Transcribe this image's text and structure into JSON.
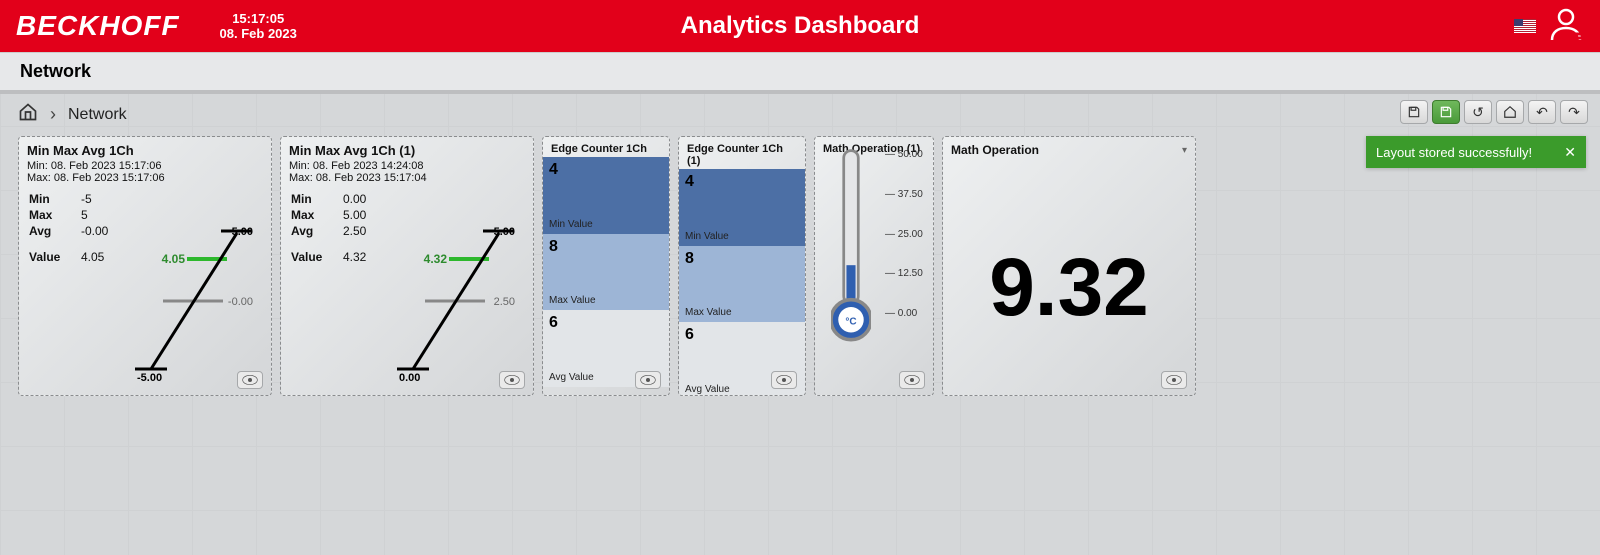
{
  "header": {
    "logo": "BECKHOFF",
    "time": "15:17:05",
    "date": "08. Feb 2023",
    "title": "Analytics Dashboard"
  },
  "tab": {
    "label": "Network"
  },
  "breadcrumb": {
    "current": "Network"
  },
  "toast": {
    "text": "Layout stored successfully!"
  },
  "widgets": {
    "mma1": {
      "title": "Min Max Avg 1Ch",
      "min_ts": "Min:  08. Feb 2023 15:17:06",
      "max_ts": "Max: 08. Feb 2023 15:17:06",
      "min_label": "Min",
      "min": "-5",
      "max_label": "Max",
      "max": "5",
      "avg_label": "Avg",
      "avg": "-0.00",
      "value_label": "Value",
      "value": "4.05",
      "scale_top": "5.00",
      "scale_mid": "-0.00",
      "scale_bot": "-5.00",
      "marker": "4.05"
    },
    "mma2": {
      "title": "Min Max Avg 1Ch (1)",
      "min_ts": "Min:  08. Feb 2023 14:24:08",
      "max_ts": "Max: 08. Feb 2023 15:17:04",
      "min_label": "Min",
      "min": "0.00",
      "max_label": "Max",
      "max": "5.00",
      "avg_label": "Avg",
      "avg": "2.50",
      "value_label": "Value",
      "value": "4.32",
      "scale_top": "5.00",
      "scale_mid": "2.50",
      "scale_bot": "0.00",
      "marker": "4.32"
    },
    "ec1": {
      "title": "Edge Counter 1Ch",
      "min": "4",
      "max": "8",
      "avg": "6",
      "min_label": "Min Value",
      "max_label": "Max Value",
      "avg_label": "Avg Value"
    },
    "ec2": {
      "title": "Edge Counter 1Ch (1)",
      "min": "4",
      "max": "8",
      "avg": "6",
      "min_label": "Min Value",
      "max_label": "Max Value",
      "avg_label": "Avg Value"
    },
    "mop1": {
      "title": "Math Operation (1)",
      "unit": "°C",
      "scale": [
        "50.00",
        "37.50",
        "25.00",
        "12.50",
        "0.00"
      ]
    },
    "mop2": {
      "title": "Math Operation",
      "value": "9.32"
    }
  }
}
